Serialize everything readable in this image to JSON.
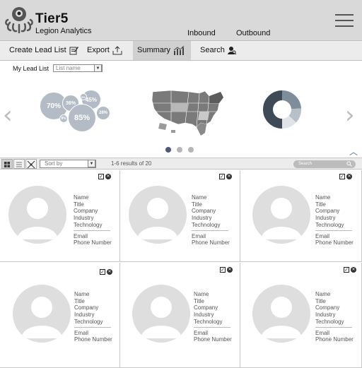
{
  "header": {
    "brand": "Tier5",
    "subtitle": "Legion Analytics",
    "nav": [
      "Inbound",
      "Outbound"
    ]
  },
  "toolbar": {
    "create_lead_list": "Create Lead List",
    "export": "Export",
    "summary": "Summary",
    "search": "Search"
  },
  "lead_list": {
    "label": "My Lead List",
    "placeholder": "List name"
  },
  "summary": {
    "bubbles": [
      "70%",
      "36%",
      "45%",
      "85%",
      "28%",
      "8%",
      "8%"
    ],
    "donut_colors": [
      "#3e4a55",
      "#7f8c99",
      "#b7c0c9",
      "#e0e4e8"
    ],
    "carousel_pages": 3,
    "active_page": 0
  },
  "list_bar": {
    "sort_placeholder": "Sort by",
    "results": "1-6 results of 20",
    "search_placeholder": "Search"
  },
  "card_fields": {
    "name": "Name",
    "title": "Title",
    "company": "Company",
    "industry": "Industry",
    "technology": "Technology",
    "email": "Email",
    "phone": "Phone Number"
  },
  "colors": {
    "header_bg": "#d9d9d9",
    "bubble": "#b3bcc6",
    "active_dot": "#4a5a78"
  }
}
